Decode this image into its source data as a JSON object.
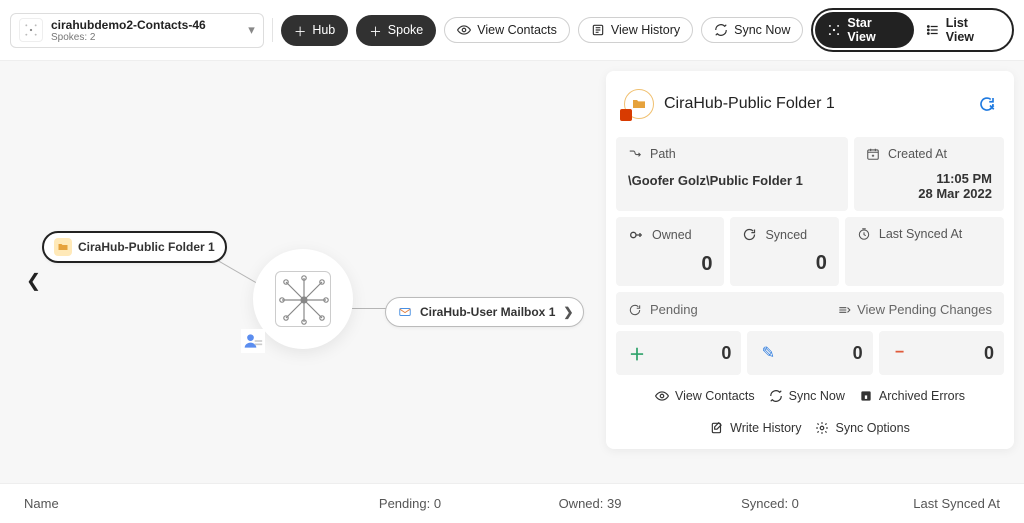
{
  "header": {
    "picker_title": "cirahubdemo2-Contacts-46",
    "picker_sub": "Spokes: 2",
    "hub_label": "Hub",
    "spoke_label": "Spoke",
    "view_contacts_label": "View Contacts",
    "view_history_label": "View History",
    "sync_now_label": "Sync Now",
    "star_view_label": "Star View",
    "list_view_label": "List View"
  },
  "graph": {
    "spoke_a_label": "CiraHub-Public Folder 1",
    "spoke_b_label": "CiraHub-User Mailbox 1"
  },
  "panel": {
    "title": "CiraHub-Public Folder 1",
    "path_label": "Path",
    "path_value": "\\Goofer Golz\\Public Folder 1",
    "created_label": "Created At",
    "created_time": "11:05 PM",
    "created_date": "28 Mar 2022",
    "owned_label": "Owned",
    "owned_value": "0",
    "synced_label": "Synced",
    "synced_value": "0",
    "last_synced_label": "Last Synced At",
    "last_synced_value": "",
    "pending_label": "Pending",
    "view_pending_label": "View Pending Changes",
    "pending_add": "0",
    "pending_edit": "0",
    "pending_remove": "0",
    "action_view_contacts": "View Contacts",
    "action_sync_now": "Sync Now",
    "action_archived_errors": "Archived Errors",
    "action_write_history": "Write History",
    "action_sync_options": "Sync Options"
  },
  "footer": {
    "name_label": "Name",
    "pending_label": "Pending: 0",
    "owned_label": "Owned: 39",
    "synced_label": "Synced: 0",
    "last_synced_label": "Last Synced At"
  }
}
